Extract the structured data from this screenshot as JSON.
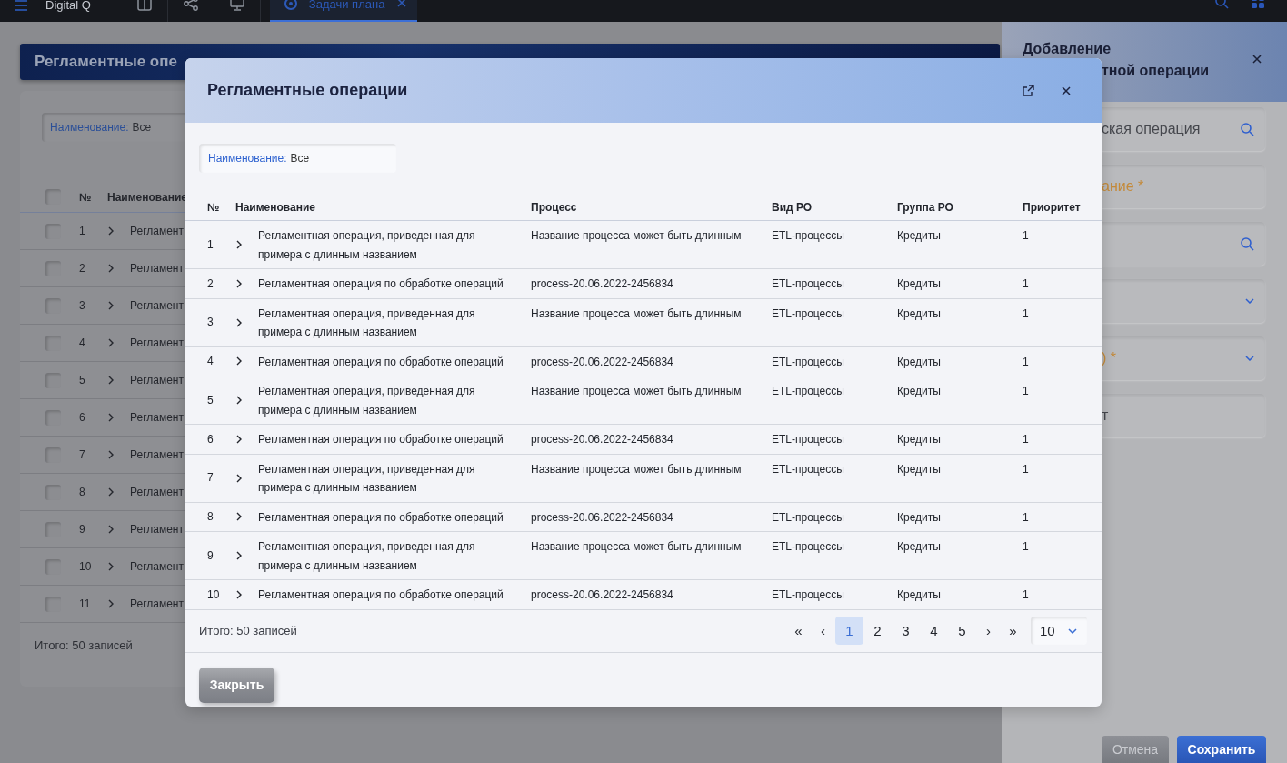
{
  "topbar": {
    "app_name": "Digital Q",
    "tabs": [
      {
        "label": "Задачи плана",
        "selected": true
      }
    ]
  },
  "page": {
    "title": "Регламентные опе",
    "header_checked": false,
    "filter": {
      "label": "Наименование:",
      "value": "Все"
    },
    "columns": [
      "№",
      "Наименование"
    ],
    "rows": [
      {
        "no": "1",
        "name": "Регламент",
        "checked": false
      },
      {
        "no": "2",
        "name": "Регламент",
        "checked": false
      },
      {
        "no": "3",
        "name": "Регламент",
        "checked": false
      },
      {
        "no": "4",
        "name": "Регламент",
        "checked": false
      },
      {
        "no": "5",
        "name": "Регламент",
        "checked": false
      },
      {
        "no": "6",
        "name": "Регламент",
        "checked": false
      },
      {
        "no": "7",
        "name": "Регламент",
        "checked": false
      },
      {
        "no": "8",
        "name": "Регламент",
        "checked": false
      },
      {
        "no": "9",
        "name": "Регламент",
        "checked": false
      },
      {
        "no": "10",
        "name": "Регламент",
        "checked": false
      },
      {
        "no": "11",
        "name": "Регламент",
        "checked": false
      }
    ],
    "total": "Итого: 50 записей"
  },
  "side_panel": {
    "title_line_1": "Добавление",
    "title_line_2": "тной операции",
    "fields": [
      {
        "kind": "search",
        "text": "ская операция",
        "required": false
      },
      {
        "kind": "text",
        "text": "ание *",
        "required": true
      },
      {
        "kind": "search"
      },
      {
        "kind": "select"
      },
      {
        "kind": "select",
        "text": ") *",
        "required": true
      },
      {
        "kind": "text",
        "text": "т",
        "required": false
      }
    ],
    "buttons": [
      {
        "label": "Отмена",
        "kind": "secondary"
      },
      {
        "label": "Сохранить",
        "kind": "primary"
      }
    ]
  },
  "modal": {
    "title": "Регламентные операции",
    "filter": {
      "label": "Наименование:",
      "value": "Все"
    },
    "columns": [
      "№",
      "Наименование",
      "Процесс",
      "Вид РО",
      "Группа РО",
      "Приоритет"
    ],
    "rows": [
      {
        "no": "1",
        "name": "Регламентная операция, приведенная для примера с длинным названием",
        "process": "Название процесса может быть длинным",
        "type": "ETL-процессы",
        "group": "Кредиты",
        "priority": "1"
      },
      {
        "no": "2",
        "name": "Регламентная операция по обработке операций",
        "process": "process-20.06.2022-2456834",
        "type": "ETL-процессы",
        "group": "Кредиты",
        "priority": "1"
      },
      {
        "no": "3",
        "name": "Регламентная операция, приведенная для примера с длинным названием",
        "process": "Название процесса может быть длинным",
        "type": "ETL-процессы",
        "group": "Кредиты",
        "priority": "1"
      },
      {
        "no": "4",
        "name": "Регламентная операция по обработке операций",
        "process": "process-20.06.2022-2456834",
        "type": "ETL-процессы",
        "group": "Кредиты",
        "priority": "1"
      },
      {
        "no": "5",
        "name": "Регламентная операция, приведенная для примера с длинным названием",
        "process": "Название процесса может быть длинным",
        "type": "ETL-процессы",
        "group": "Кредиты",
        "priority": "1"
      },
      {
        "no": "6",
        "name": "Регламентная операция по обработке операций",
        "process": "process-20.06.2022-2456834",
        "type": "ETL-процессы",
        "group": "Кредиты",
        "priority": "1"
      },
      {
        "no": "7",
        "name": "Регламентная операция, приведенная для примера с длинным названием",
        "process": "Название процесса может быть длинным",
        "type": "ETL-процессы",
        "group": "Кредиты",
        "priority": "1"
      },
      {
        "no": "8",
        "name": "Регламентная операция по обработке операций",
        "process": "process-20.06.2022-2456834",
        "type": "ETL-процессы",
        "group": "Кредиты",
        "priority": "1"
      },
      {
        "no": "9",
        "name": "Регламентная операция, приведенная для примера с длинным названием",
        "process": "Название процесса может быть длинным",
        "type": "ETL-процессы",
        "group": "Кредиты",
        "priority": "1"
      },
      {
        "no": "10",
        "name": "Регламентная операция по обработке операций",
        "process": "process-20.06.2022-2456834",
        "type": "ETL-процессы",
        "group": "Кредиты",
        "priority": "1"
      }
    ],
    "total": "Итого: 50 записей",
    "pagination": {
      "first": "«",
      "prev": "‹",
      "pages": [
        {
          "label": "1",
          "selected": true
        },
        {
          "label": "2",
          "selected": false
        },
        {
          "label": "3",
          "selected": false
        },
        {
          "label": "4",
          "selected": false
        },
        {
          "label": "5",
          "selected": false
        }
      ],
      "next": "›",
      "last": "»",
      "page_size": "10"
    },
    "close_button": "Закрыть"
  }
}
